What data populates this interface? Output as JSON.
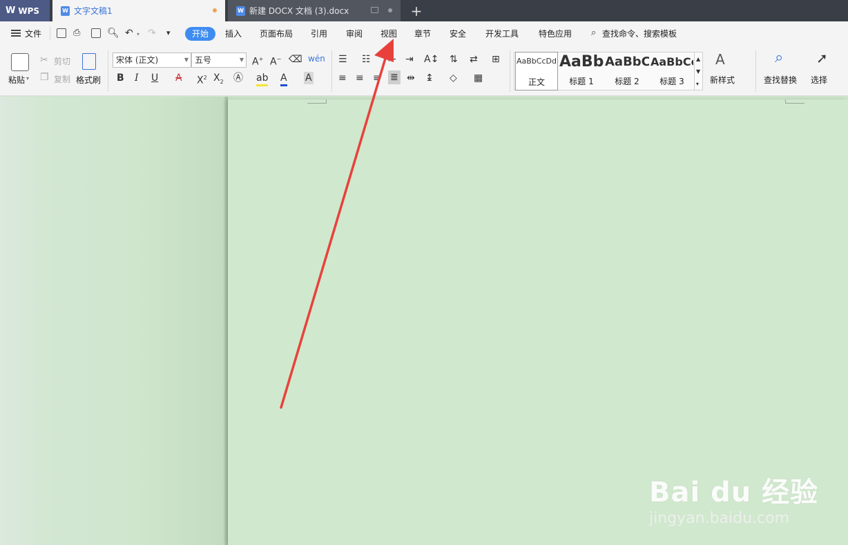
{
  "tabs": {
    "wps": "WPS",
    "doc1": "文字文稿1",
    "doc2": "新建 DOCX 文档 (3).docx",
    "add": "+"
  },
  "menu": {
    "file": "文件",
    "start": "开始",
    "insert": "插入",
    "layout": "页面布局",
    "references": "引用",
    "review": "审阅",
    "view": "视图",
    "section": "章节",
    "security": "安全",
    "devtools": "开发工具",
    "special": "特色应用",
    "search": "查找命令、搜索模板"
  },
  "ribbon": {
    "paste": "粘贴",
    "cut": "剪切",
    "copy": "复制",
    "format_painter": "格式刷",
    "font_name": "宋体 (正文)",
    "font_size": "五号",
    "styles": [
      {
        "sample": "AaBbCcDd",
        "label": "正文"
      },
      {
        "sample": "AaBb",
        "label": "标题 1"
      },
      {
        "sample": "AaBbC",
        "label": "标题 2"
      },
      {
        "sample": "AaBbCc",
        "label": "标题 3"
      }
    ],
    "new_style": "新样式",
    "find_replace": "查找替换",
    "select": "选择"
  },
  "watermark": {
    "brand": "Bai du 经验",
    "url": "jingyan.baidu.com"
  },
  "colors": {
    "accent": "#3f8cf0",
    "page": "#d0e8cd",
    "arrow": "#e8413c"
  }
}
